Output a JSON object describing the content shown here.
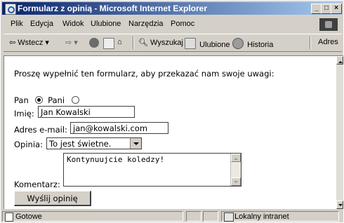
{
  "window": {
    "title": "Formularz z opinią - Microsoft Internet Explorer",
    "controls": {
      "minimize": "_",
      "maximize": "□",
      "close": "×"
    }
  },
  "menu": [
    "Plik",
    "Edycja",
    "Widok",
    "Ulubione",
    "Narzędzia",
    "Pomoc"
  ],
  "toolbar": {
    "back": "Wstecz",
    "search": "Wyszukaj",
    "favorites": "Ulubione",
    "history": "Historia",
    "address": "Adres"
  },
  "form": {
    "intro": "Proszę wypełnić ten formularz, aby przekazać nam swoje uwagi:",
    "salutation": {
      "pan": "Pan",
      "pani": "Pani",
      "selected": "pan"
    },
    "name_label": "Imię:",
    "name_value": "Jan Kowalski",
    "email_label": "Adres e-mail:",
    "email_value": "jan@kowalski.com",
    "opinion_label": "Opinia:",
    "opinion_value": "To jest świetne.",
    "comment_label": "Komentarz:",
    "comment_value": "Kontynuujcie koledzy!",
    "submit": "Wyślij opinię"
  },
  "status": {
    "text": "Gotowe",
    "zone": "Lokalny intranet"
  }
}
